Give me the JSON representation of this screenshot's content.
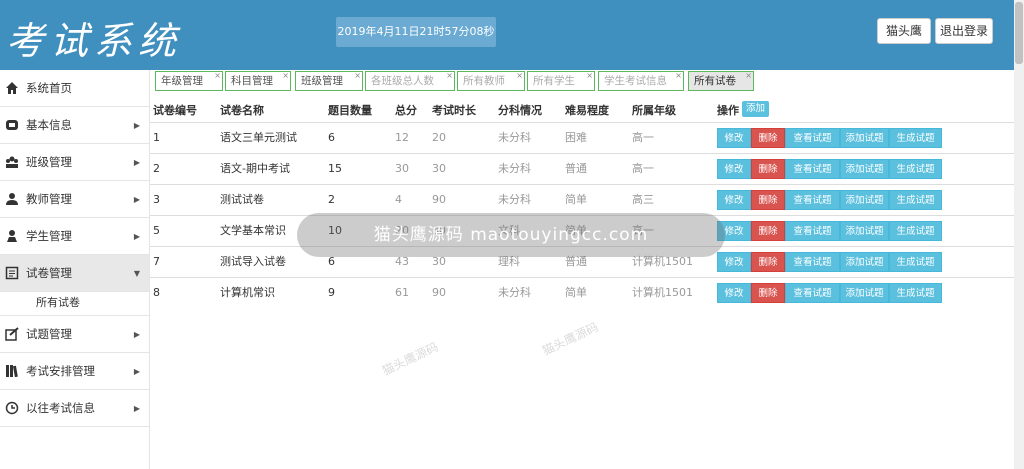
{
  "header": {
    "logo": "考试系统",
    "datetime": "2019年4月11日21时57分08秒",
    "user_label": "猫头鹰",
    "logout_label": "退出登录"
  },
  "sidebar": {
    "items": [
      {
        "label": "系统首页",
        "icon": "home-icon"
      },
      {
        "label": "基本信息",
        "icon": "info-icon"
      },
      {
        "label": "班级管理",
        "icon": "class-icon"
      },
      {
        "label": "教师管理",
        "icon": "teacher-icon"
      },
      {
        "label": "学生管理",
        "icon": "student-icon"
      },
      {
        "label": "试卷管理",
        "icon": "paper-icon",
        "active": true
      },
      {
        "label": "试题管理",
        "icon": "question-icon"
      },
      {
        "label": "考试安排管理",
        "icon": "books-icon"
      },
      {
        "label": "以往考试信息",
        "icon": "clock-icon"
      }
    ],
    "subitem": "所有试卷"
  },
  "tabs": [
    {
      "label": "年级管理"
    },
    {
      "label": "科目管理"
    },
    {
      "label": "班级管理"
    },
    {
      "label": "各班级总人数"
    },
    {
      "label": "所有教师"
    },
    {
      "label": "所有学生"
    },
    {
      "label": "学生考试信息"
    },
    {
      "label": "所有试卷"
    }
  ],
  "table": {
    "headers": [
      "试卷编号",
      "试卷名称",
      "题目数量",
      "总分",
      "考试时长",
      "分科情况",
      "难易程度",
      "所属年级",
      "操作"
    ],
    "add_label": "添加",
    "actions": [
      "修改",
      "删除",
      "查看试题",
      "添加试题",
      "生成试题"
    ],
    "rows": [
      {
        "id": "1",
        "name": "语文三单元测试",
        "count": "6",
        "score": "12",
        "duration": "20",
        "subject": "未分科",
        "difficulty": "困难",
        "grade": "高一"
      },
      {
        "id": "2",
        "name": "语文-期中考试",
        "count": "15",
        "score": "30",
        "duration": "30",
        "subject": "未分科",
        "difficulty": "普通",
        "grade": "高一"
      },
      {
        "id": "3",
        "name": "测试试卷",
        "count": "2",
        "score": "4",
        "duration": "90",
        "subject": "未分科",
        "difficulty": "简单",
        "grade": "高三"
      },
      {
        "id": "5",
        "name": "文学基本常识",
        "count": "10",
        "score": "20",
        "duration": "30",
        "subject": "文科",
        "difficulty": "简单",
        "grade": "高一"
      },
      {
        "id": "7",
        "name": "测试导入试卷",
        "count": "6",
        "score": "43",
        "duration": "30",
        "subject": "理科",
        "difficulty": "普通",
        "grade": "计算机1501"
      },
      {
        "id": "8",
        "name": "计算机常识",
        "count": "9",
        "score": "61",
        "duration": "90",
        "subject": "未分科",
        "difficulty": "简单",
        "grade": "计算机1501"
      }
    ]
  },
  "watermark": {
    "main": "猫头鹰源码 maotouyingcc.com",
    "small": "猫头鹰源码"
  }
}
